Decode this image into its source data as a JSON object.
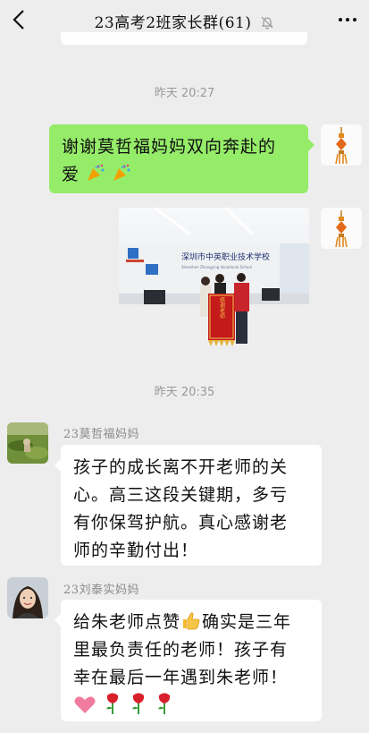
{
  "header": {
    "title": "23高考2班家长群(61)"
  },
  "messages": {
    "t1": "昨天 20:27",
    "m1_line1": "谢谢莫哲福妈妈双向奔赴的",
    "m1_line2": "爱",
    "photo": {
      "sign_text": "深圳市中英职业技术学校",
      "sub_text": "Shenzhen Zhongying Vocational School",
      "banner_text": "感谢老师"
    },
    "t2": "昨天 20:35",
    "n1": "23莫哲福妈妈",
    "m2_lines": [
      "孩子的成长离不开老师的关",
      "心。高三这段关键期，多亏",
      "有你保驾护航。真心感谢老",
      "师的辛勤付出！"
    ],
    "n2": "23刘泰实妈妈",
    "m3_lines": [
      "给朱老师点赞",
      "确实是三年",
      "里最负责任的老师！孩子有",
      "幸在最后一年遇到朱老师！"
    ]
  },
  "colors": {
    "me_bubble": "#95ec69",
    "other_bubble": "#ffffff",
    "background": "#ededed"
  },
  "icons": [
    "back-icon",
    "mute-bell-icon",
    "more-icon",
    "party-popper-icon",
    "thumbs-up-icon",
    "heart-icon",
    "rose-icon"
  ]
}
